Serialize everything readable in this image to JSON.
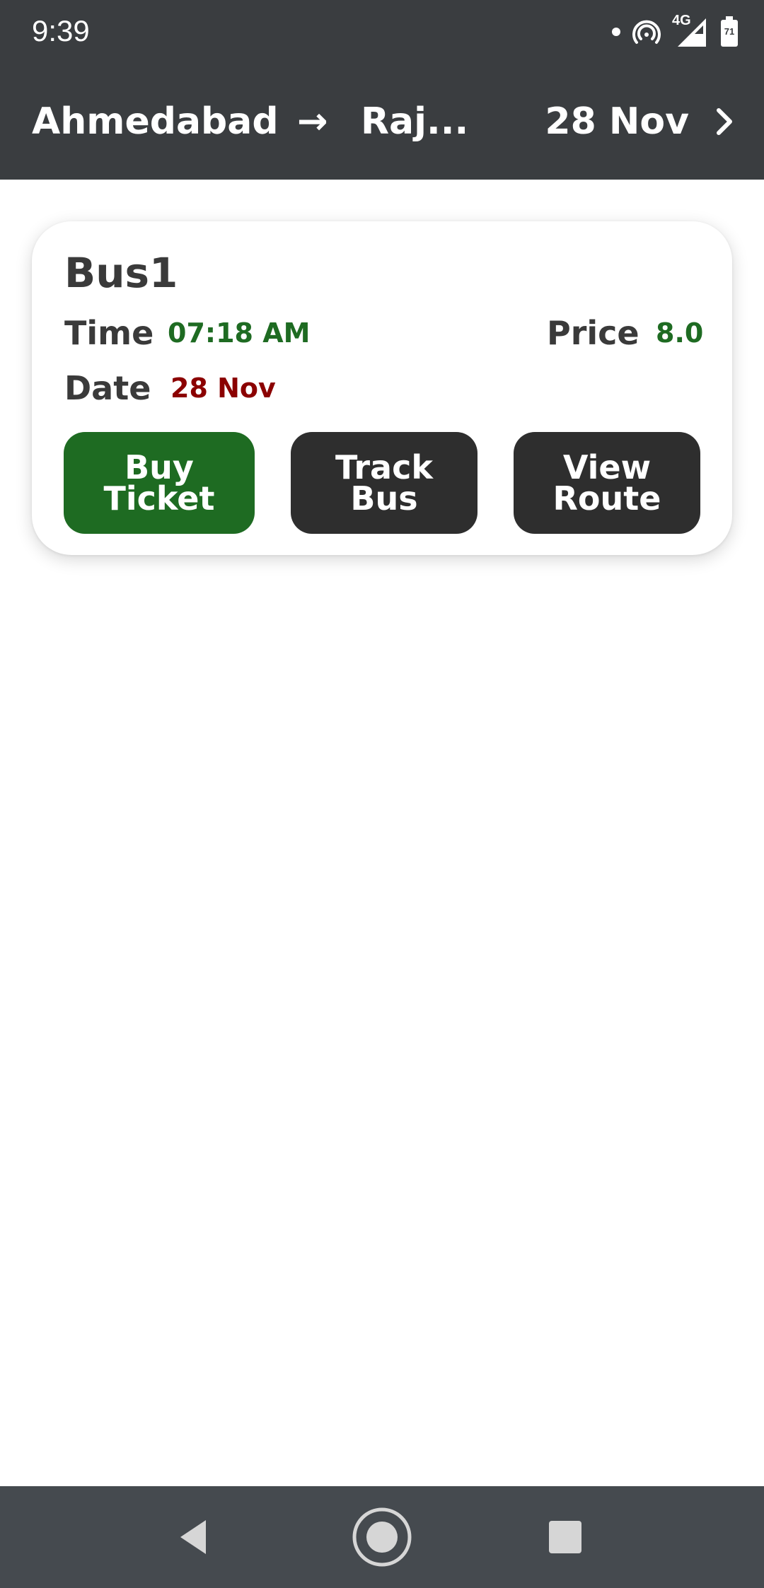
{
  "status_bar": {
    "time": "9:39",
    "icons": [
      "notification-dot-icon",
      "hotspot-icon",
      "signal-4g-icon",
      "battery-icon"
    ],
    "network_label": "4G",
    "battery_level": "71"
  },
  "header": {
    "from": "Ahmedabad",
    "arrow": "→",
    "to": "Raj...",
    "date": "28 Nov",
    "next_icon": "chevron-right-icon"
  },
  "buses": [
    {
      "name": "Bus1",
      "time_label": "Time",
      "time_value": "07:18 AM",
      "price_label": "Price",
      "price_value": "8.0",
      "date_label": "Date",
      "date_value": "28 Nov",
      "buttons": {
        "buy": [
          "Buy",
          "Ticket"
        ],
        "track": [
          "Track",
          "Bus"
        ],
        "route": [
          "View",
          "Route"
        ]
      }
    }
  ],
  "nav_bar": {
    "icons": [
      "back-icon",
      "home-icon",
      "recents-icon"
    ]
  },
  "colors": {
    "header_bg": "#3a3d40",
    "nav_bg": "#454a4f",
    "green_accent": "#1e6b22",
    "dark_button": "#2e2e2e",
    "date_red": "#8b0000",
    "label_text": "#3a3a3a"
  }
}
